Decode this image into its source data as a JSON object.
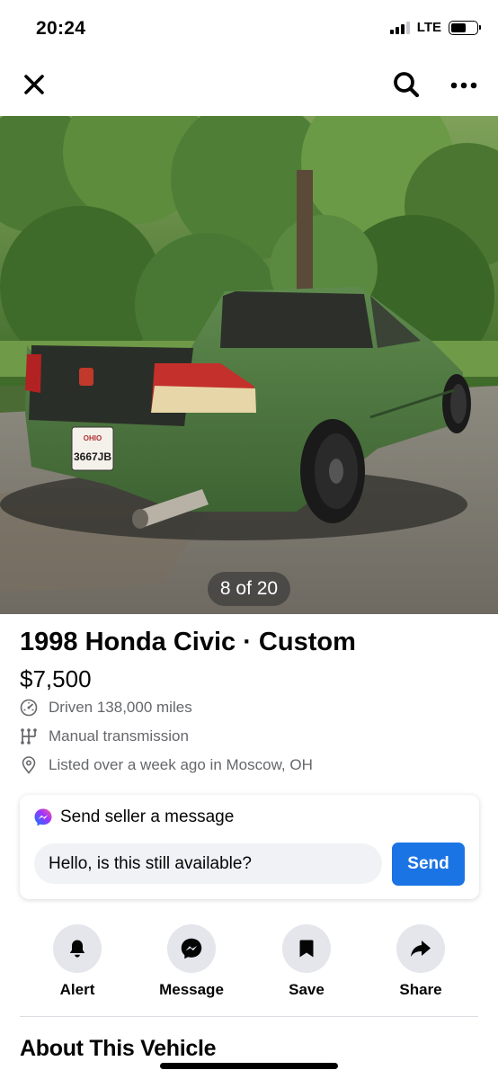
{
  "status_bar": {
    "time": "20:24",
    "network": "LTE",
    "signal_bars_active": 3,
    "signal_bars_total": 4,
    "battery_level": 0.6
  },
  "nav": {
    "close_icon": "close-icon",
    "search_icon": "search-icon",
    "more_icon": "more-horizontal-icon"
  },
  "photo": {
    "counter": "8 of 20",
    "current": 8,
    "total": 20,
    "plate_text": "3667JB",
    "plate_state": "OHIO"
  },
  "listing": {
    "title": "1998 Honda Civic · Custom",
    "price": "$7,500",
    "details": [
      {
        "icon": "odometer-icon",
        "text": "Driven 138,000 miles"
      },
      {
        "icon": "gear-shift-icon",
        "text": "Manual transmission"
      },
      {
        "icon": "location-pin-icon",
        "text": "Listed over a week ago in Moscow, OH"
      }
    ]
  },
  "message": {
    "icon": "messenger-icon",
    "heading": "Send seller a message",
    "input_value": "Hello, is this still available?",
    "send_label": "Send"
  },
  "actions": [
    {
      "icon": "bell-icon",
      "label": "Alert"
    },
    {
      "icon": "messenger-icon",
      "label": "Message"
    },
    {
      "icon": "bookmark-icon",
      "label": "Save"
    },
    {
      "icon": "share-icon",
      "label": "Share"
    }
  ],
  "about": {
    "title": "About This Vehicle"
  },
  "colors": {
    "accent": "#1b74e4",
    "text_primary": "#050505",
    "text_secondary": "#65676b",
    "chip_bg": "#e4e6eb",
    "input_bg": "#f0f2f5"
  }
}
